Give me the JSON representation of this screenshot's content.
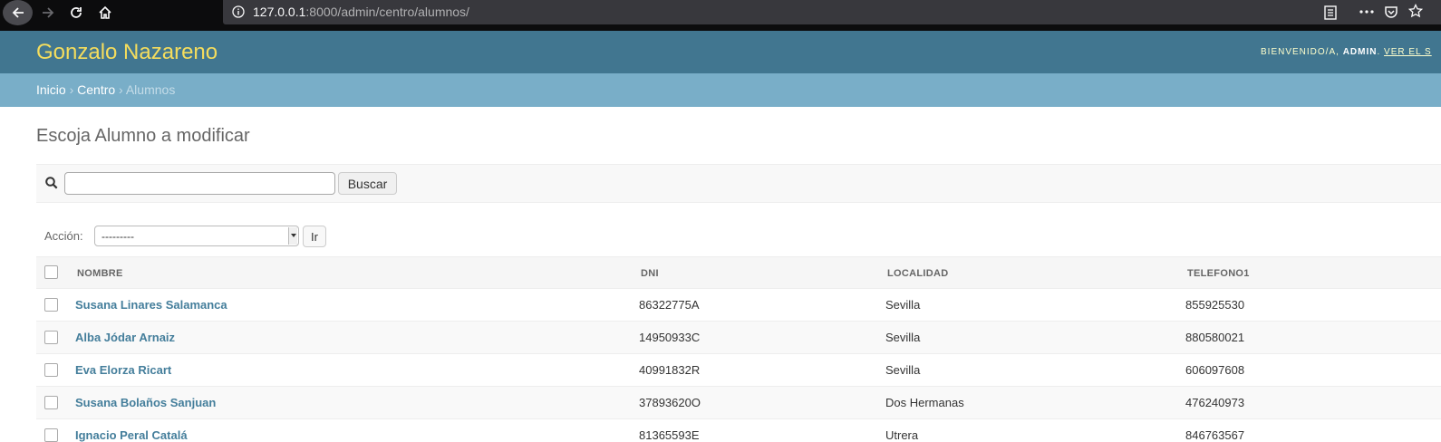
{
  "browser": {
    "url_host": "127.0.0.1",
    "url_rest": ":8000/admin/centro/alumnos/"
  },
  "header": {
    "site_name": "Gonzalo Nazareno",
    "welcome": "BIENVENIDO/A,",
    "user": "ADMIN",
    "view_site": "VER EL S"
  },
  "breadcrumbs": {
    "home": "Inicio",
    "app": "Centro",
    "sep1": " › ",
    "sep2": " › ",
    "current": "Alumnos"
  },
  "page": {
    "title": "Escoja Alumno a modificar"
  },
  "search": {
    "value": "",
    "button": "Buscar"
  },
  "actions": {
    "label": "Acción:",
    "selected": "---------",
    "go": "Ir"
  },
  "table": {
    "columns": [
      "NOMBRE",
      "DNI",
      "LOCALIDAD",
      "TELEFONO1"
    ],
    "rows": [
      {
        "nombre": "Susana Linares Salamanca",
        "dni": "86322775A",
        "localidad": "Sevilla",
        "telefono1": "855925530"
      },
      {
        "nombre": "Alba Jódar Arnaiz",
        "dni": "14950933C",
        "localidad": "Sevilla",
        "telefono1": "880580021"
      },
      {
        "nombre": "Eva Elorza Ricart",
        "dni": "40991832R",
        "localidad": "Sevilla",
        "telefono1": "606097608"
      },
      {
        "nombre": "Susana Bolaños Sanjuan",
        "dni": "37893620O",
        "localidad": "Dos Hermanas",
        "telefono1": "476240973"
      },
      {
        "nombre": "Ignacio Peral Catalá",
        "dni": "81365593E",
        "localidad": "Utrera",
        "telefono1": "846763567"
      }
    ]
  }
}
